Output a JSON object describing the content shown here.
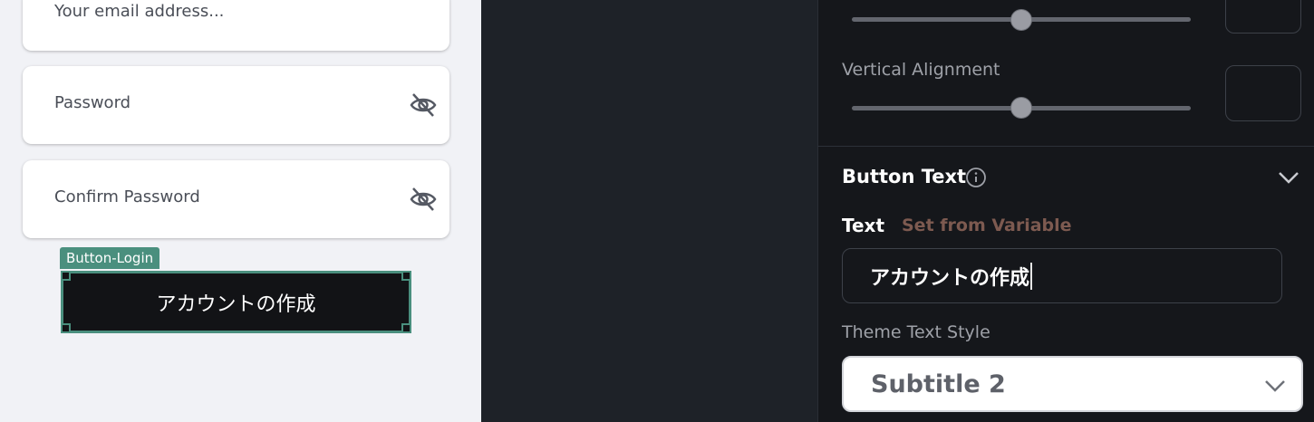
{
  "form": {
    "email_placeholder": "Your email address...",
    "password_placeholder": "Password",
    "confirm_password_placeholder": "Confirm Password"
  },
  "selection": {
    "widget_name": "Button-Login"
  },
  "canvas_button": {
    "label": "アカウントの作成"
  },
  "panel": {
    "vertical_alignment_label": "Vertical Alignment",
    "section_title": "Button Text",
    "text_label": "Text",
    "set_from_variable": "Set from Variable",
    "text_value": "アカウントの作成",
    "theme_text_style_label": "Theme Text Style",
    "theme_text_style_value": "Subtitle 2"
  },
  "colors": {
    "accent_selection": "#4a8f7e",
    "set_from_variable": "#7d5a50",
    "panel_bg": "#15171b"
  },
  "icons": {
    "password_visibility": "eye-off-icon",
    "info": "info-icon",
    "collapse": "chevron-down-icon"
  }
}
